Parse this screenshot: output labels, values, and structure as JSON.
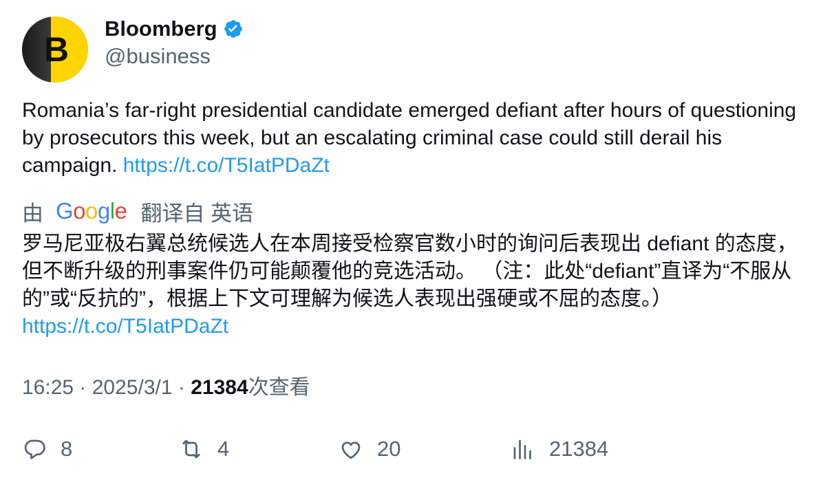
{
  "author": {
    "display_name": "Bloomberg",
    "handle": "@business",
    "avatar_letter": "B",
    "verified": true,
    "avatar_color": "#ffd400"
  },
  "tweet": {
    "text": "Romania’s far-right presidential candidate emerged defiant after hours of questioning by prosecutors this week, but an escalating criminal case could still derail his campaign. ",
    "link": "https://t.co/T5IatPDaZt"
  },
  "translation": {
    "by_label": "由",
    "provider_letters": [
      "G",
      "o",
      "o",
      "g",
      "l",
      "e"
    ],
    "from_label": "翻译自 英语",
    "text": "罗马尼亚极右翼总统候选人在本周接受检察官数小时的询问后表现出 defiant 的态度，但不断升级的刑事案件仍可能颠覆他的竞选活动。 （注：此处“defiant”直译为“不服从的”或“反抗的”，根据上下文可理解为候选人表现出强硬或不屈的态度。） ",
    "link": "https://t.co/T5IatPDaZt"
  },
  "meta": {
    "time": "16:25",
    "sep1": " · ",
    "date": "2025/3/1",
    "sep2": " · ",
    "views_count": "21384",
    "views_label": "次查看"
  },
  "actions": {
    "replies": "8",
    "retweets": "4",
    "likes": "20",
    "views": "21384"
  },
  "colors": {
    "link": "#1d9bf0",
    "secondary_text": "#536471",
    "primary_text": "#0f1419"
  }
}
